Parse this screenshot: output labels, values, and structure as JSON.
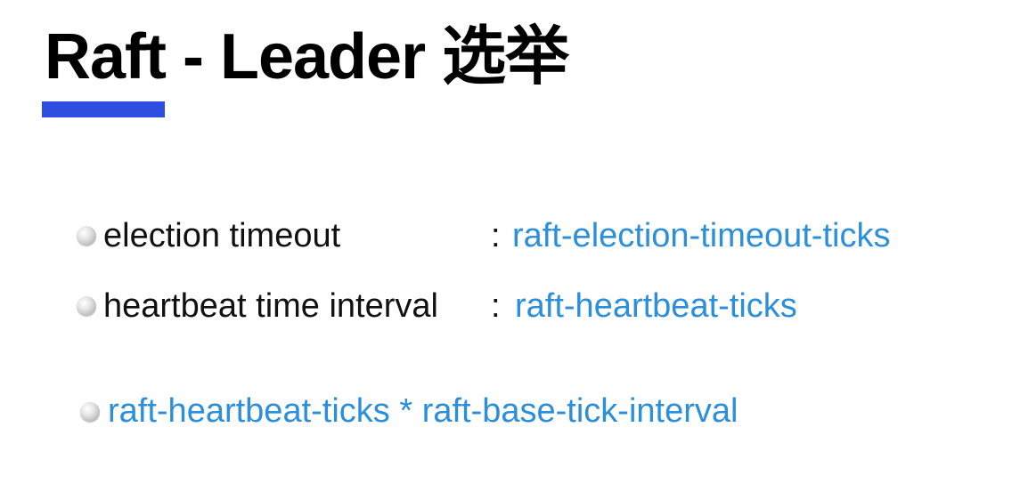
{
  "slide": {
    "title": "Raft - Leader 选举",
    "accent_color": "#2f4de0",
    "param_color": "#2b8fd9",
    "bullets": [
      {
        "term": "election timeout",
        "separator": ":",
        "param": "raft-election-timeout-ticks"
      },
      {
        "term": "heartbeat time interval",
        "separator": ":",
        "param": "raft-heartbeat-ticks"
      }
    ],
    "formula": "raft-heartbeat-ticks * raft-base-tick-interval"
  }
}
